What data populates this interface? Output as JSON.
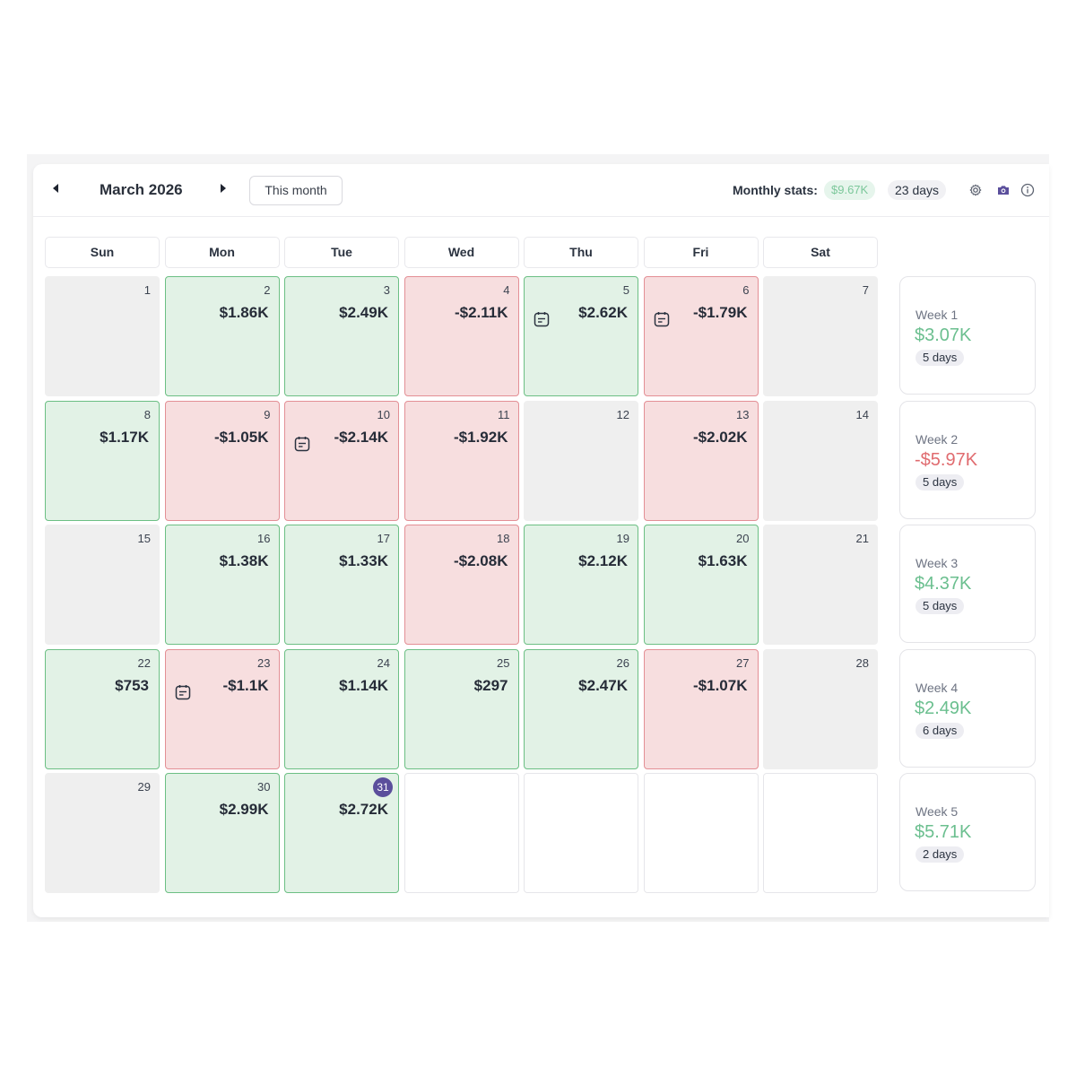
{
  "header": {
    "month_title": "March 2026",
    "this_month_label": "This month",
    "stats_label": "Monthly stats:",
    "stats_profit": "$9.67K",
    "stats_days": "23 days",
    "icons": [
      "gear-icon",
      "camera-icon",
      "info-icon"
    ],
    "accent_color": "#5b4f9c"
  },
  "weekdays": [
    "Sun",
    "Mon",
    "Tue",
    "Wed",
    "Thu",
    "Fri",
    "Sat"
  ],
  "colors": {
    "profit_bg": "#e2f2e6",
    "profit_border": "#6cbf84",
    "loss_bg": "#f7dedf",
    "loss_border": "#e38f95",
    "no_trade_bg": "#efefef",
    "profit_text": "#6bbf8f",
    "loss_text": "#e06b6f"
  },
  "days": [
    {
      "day": "1",
      "type": "empty"
    },
    {
      "day": "2",
      "type": "pos",
      "pnl": "$1.86K"
    },
    {
      "day": "3",
      "type": "pos",
      "pnl": "$2.49K"
    },
    {
      "day": "4",
      "type": "neg",
      "pnl": "-$2.11K"
    },
    {
      "day": "5",
      "type": "pos",
      "pnl": "$2.62K",
      "note": true
    },
    {
      "day": "6",
      "type": "neg",
      "pnl": "-$1.79K",
      "note": true
    },
    {
      "day": "7",
      "type": "empty"
    },
    {
      "day": "8",
      "type": "pos",
      "pnl": "$1.17K"
    },
    {
      "day": "9",
      "type": "neg",
      "pnl": "-$1.05K"
    },
    {
      "day": "10",
      "type": "neg",
      "pnl": "-$2.14K",
      "note": true
    },
    {
      "day": "11",
      "type": "neg",
      "pnl": "-$1.92K"
    },
    {
      "day": "12",
      "type": "empty"
    },
    {
      "day": "13",
      "type": "neg",
      "pnl": "-$2.02K"
    },
    {
      "day": "14",
      "type": "empty"
    },
    {
      "day": "15",
      "type": "empty"
    },
    {
      "day": "16",
      "type": "pos",
      "pnl": "$1.38K"
    },
    {
      "day": "17",
      "type": "pos",
      "pnl": "$1.33K"
    },
    {
      "day": "18",
      "type": "neg",
      "pnl": "-$2.08K"
    },
    {
      "day": "19",
      "type": "pos",
      "pnl": "$2.12K"
    },
    {
      "day": "20",
      "type": "pos",
      "pnl": "$1.63K"
    },
    {
      "day": "21",
      "type": "empty"
    },
    {
      "day": "22",
      "type": "pos",
      "pnl": "$753"
    },
    {
      "day": "23",
      "type": "neg",
      "pnl": "-$1.1K",
      "note": true
    },
    {
      "day": "24",
      "type": "pos",
      "pnl": "$1.14K"
    },
    {
      "day": "25",
      "type": "pos",
      "pnl": "$297"
    },
    {
      "day": "26",
      "type": "pos",
      "pnl": "$2.47K"
    },
    {
      "day": "27",
      "type": "neg",
      "pnl": "-$1.07K"
    },
    {
      "day": "28",
      "type": "empty"
    },
    {
      "day": "29",
      "type": "empty"
    },
    {
      "day": "30",
      "type": "pos",
      "pnl": "$2.99K"
    },
    {
      "day": "31",
      "type": "pos",
      "pnl": "$2.72K",
      "today": true
    },
    {
      "day": "",
      "type": "blank"
    },
    {
      "day": "",
      "type": "blank"
    },
    {
      "day": "",
      "type": "blank"
    },
    {
      "day": "",
      "type": "blank"
    }
  ],
  "weeks": [
    {
      "label": "Week 1",
      "value": "$3.07K",
      "days": "5 days",
      "type": "pos"
    },
    {
      "label": "Week 2",
      "value": "-$5.97K",
      "days": "5 days",
      "type": "neg"
    },
    {
      "label": "Week 3",
      "value": "$4.37K",
      "days": "5 days",
      "type": "pos"
    },
    {
      "label": "Week 4",
      "value": "$2.49K",
      "days": "6 days",
      "type": "pos"
    },
    {
      "label": "Week 5",
      "value": "$5.71K",
      "days": "2 days",
      "type": "pos"
    }
  ]
}
